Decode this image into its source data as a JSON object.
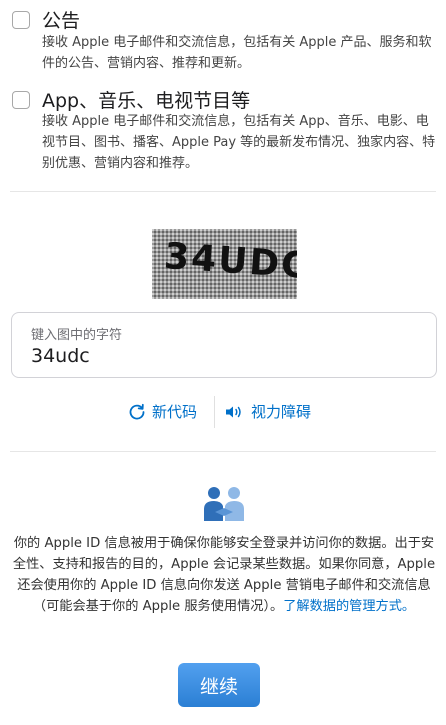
{
  "options": [
    {
      "title": "公告",
      "description": "接收 Apple 电子邮件和交流信息，包括有关 Apple 产品、服务和软件的公告、营销内容、推荐和更新。",
      "checked": false
    },
    {
      "title": "App、音乐、电视节目等",
      "description": "接收 Apple 电子邮件和交流信息，包括有关 App、音乐、电影、电视节目、图书、播客、Apple Pay 等的最新发布情况、独家内容、特别优惠、营销内容和推荐。",
      "checked": false
    }
  ],
  "captcha": {
    "image_text": "34UDC"
  },
  "captcha_input": {
    "label": "键入图中的字符",
    "value": "34udc"
  },
  "captcha_actions": {
    "new_code": "新代码",
    "accessibility": "视力障碍"
  },
  "privacy": {
    "text": "你的 Apple ID 信息被用于确保你能够安全登录并访问你的数据。出于安全性、支持和报告的目的，Apple 会记录某些数据。如果你同意，Apple 还会使用你的 Apple ID 信息向你发送 Apple 营销电子邮件和交流信息（可能会基于你的 Apple 服务使用情况）。",
    "link": "了解数据的管理方式。"
  },
  "continue_button": "继续",
  "colors": {
    "link": "#0070c9",
    "button": "#3b8de0"
  }
}
